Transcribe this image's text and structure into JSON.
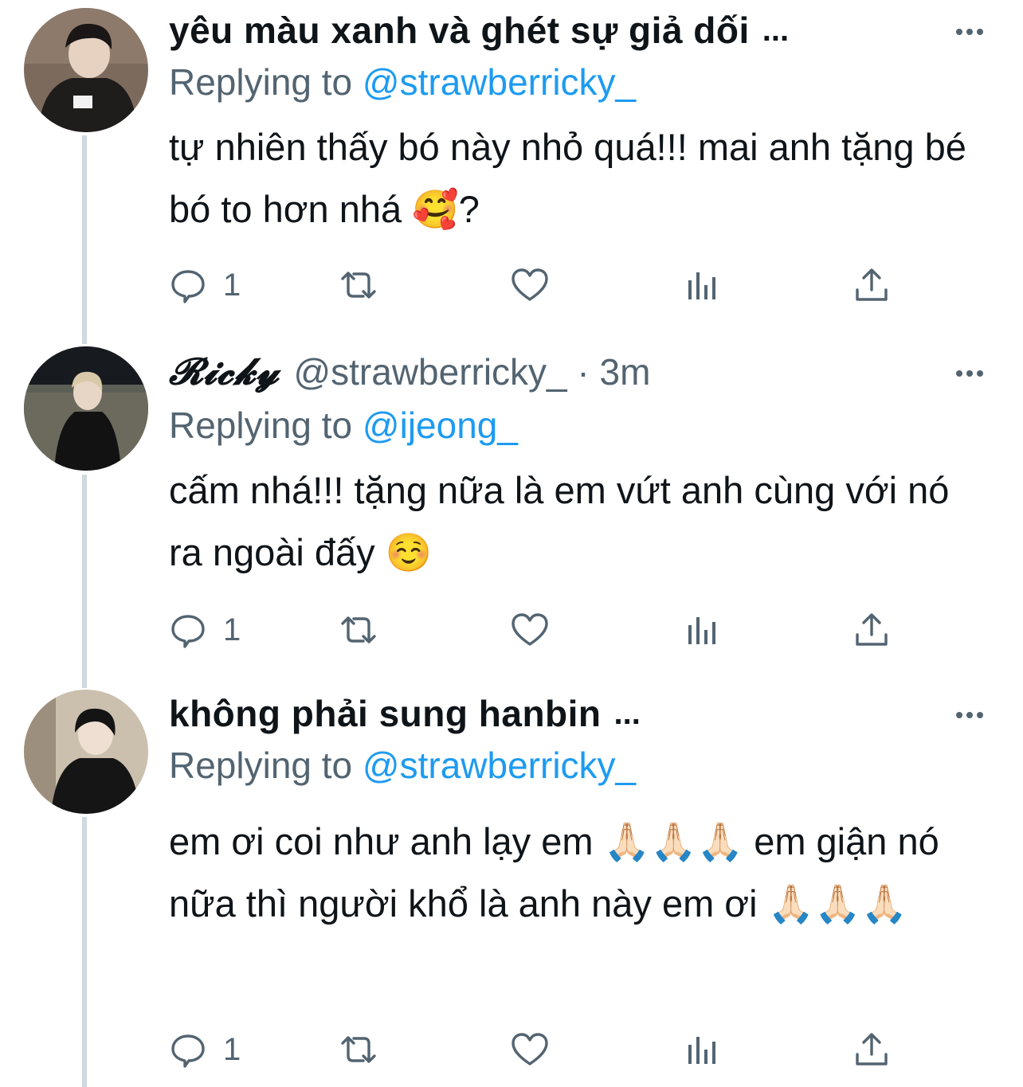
{
  "tweets": [
    {
      "display_name": "yêu màu xanh và ghét sự giả dối",
      "name_truncation": "...",
      "handle": "",
      "replying_prefix": "Replying to",
      "replying_to": "@strawberricky_",
      "text": "tự nhiên thấy bó này nhỏ quá!!! mai anh tặng bé bó to hơn nhá 🥰?",
      "reply_count": "1",
      "more_icon": "more-dots-icon"
    },
    {
      "display_name": "𝓡𝓲𝓬𝓴𝔂",
      "handle": "@strawberricky_ · 3m",
      "replying_prefix": "Replying to",
      "replying_to": "@ijeong_",
      "text": "cấm nhá!!! tặng nữa là em vứt anh cùng với nó ra ngoài đấy ☺️",
      "reply_count": "1"
    },
    {
      "display_name": "không phải sung hanbin",
      "name_truncation": "...",
      "handle": "",
      "replying_prefix": "Replying to",
      "replying_to": "@strawberricky_",
      "text": "em ơi coi như anh lạy em 🙏🏻🙏🏻🙏🏻 em giận nó nữa thì người khổ là anh này em ơi 🙏🏻🙏🏻🙏🏻",
      "reply_count": "1"
    }
  ],
  "icons": [
    "reply-icon",
    "retweet-icon",
    "like-icon",
    "analytics-icon",
    "share-icon"
  ],
  "colors": {
    "secondary_text": "#536471",
    "mention": "#1d9bf0",
    "thread_line": "#cfd9de"
  }
}
